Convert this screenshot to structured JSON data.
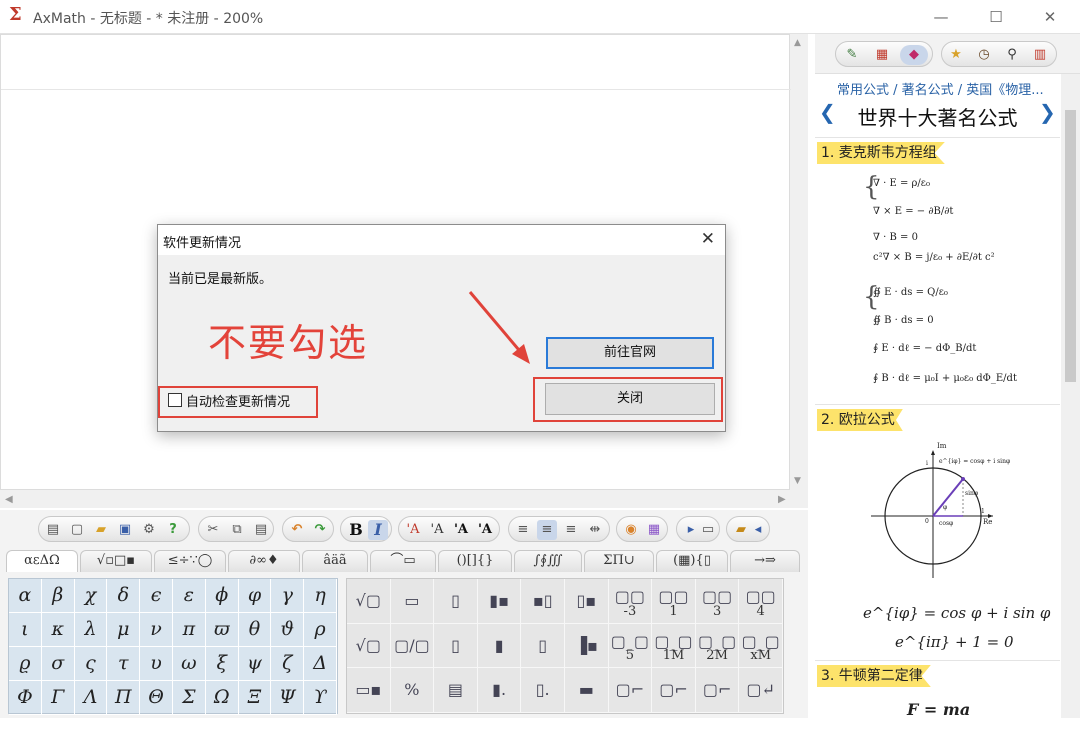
{
  "window": {
    "app_icon": "Σ",
    "title": "AxMath - 无标题 - * 未注册 - 200%",
    "minimize": "—",
    "maximize": "☐",
    "close": "✕"
  },
  "editor": {
    "scroll_up": "▲",
    "scroll_down": "▼",
    "scroll_left": "◀",
    "scroll_right": "▶"
  },
  "toolbar": {
    "bold": "B",
    "italic": "I",
    "font_a1": "'A",
    "font_a2": "'A",
    "font_a3": "'A",
    "font_a4": "'A",
    "undo": "↶",
    "redo": "↷",
    "help": "?"
  },
  "symbol_tabs": [
    "αεΔΩ",
    "√▫□▪",
    "≤÷∵◯",
    "∂∞♦",
    "âäã",
    "⌒▭",
    "()[]{}",
    "∫∮∭",
    "ΣΠ∪",
    "(▦){▯",
    "→⇒"
  ],
  "greek_letters": [
    "α",
    "β",
    "χ",
    "δ",
    "ϵ",
    "ε",
    "ϕ",
    "φ",
    "γ",
    "η",
    "ι",
    "κ",
    "λ",
    "μ",
    "ν",
    "π",
    "ϖ",
    "θ",
    "ϑ",
    "ρ",
    "ϱ",
    "σ",
    "ς",
    "τ",
    "υ",
    "ω",
    "ξ",
    "ψ",
    "ζ",
    "Δ",
    "Φ",
    "Γ",
    "Λ",
    "Π",
    "Θ",
    "Σ",
    "Ω",
    "Ξ",
    "Ψ",
    "ϒ"
  ],
  "templates": [
    {
      "g": "√▢",
      "s": ""
    },
    {
      "g": "▭",
      "s": ""
    },
    {
      "g": "▯",
      "s": ""
    },
    {
      "g": "▮▪",
      "s": ""
    },
    {
      "g": "▪▯",
      "s": ""
    },
    {
      "g": "▯▪",
      "s": ""
    },
    {
      "g": "▢▢",
      "s": "-3"
    },
    {
      "g": "▢▢",
      "s": "1"
    },
    {
      "g": "▢▢",
      "s": "3"
    },
    {
      "g": "▢▢",
      "s": "4"
    },
    {
      "g": "√▢",
      "s": ""
    },
    {
      "g": "▢/▢",
      "s": ""
    },
    {
      "g": "▯",
      "s": ""
    },
    {
      "g": "▮",
      "s": ""
    },
    {
      "g": "▯",
      "s": ""
    },
    {
      "g": "▐▪",
      "s": ""
    },
    {
      "g": "▢_▢",
      "s": "5"
    },
    {
      "g": "▢_▢",
      "s": "1M"
    },
    {
      "g": "▢_▢",
      "s": "2M"
    },
    {
      "g": "▢_▢",
      "s": "xM"
    },
    {
      "g": "▭▪",
      "s": ""
    },
    {
      "g": "%",
      "s": ""
    },
    {
      "g": "▤",
      "s": ""
    },
    {
      "g": "▮.",
      "s": ""
    },
    {
      "g": "▯.",
      "s": ""
    },
    {
      "g": "▬",
      "s": ""
    },
    {
      "g": "▢⌐",
      "s": ""
    },
    {
      "g": "▢⌐",
      "s": ""
    },
    {
      "g": "▢⌐",
      "s": ""
    },
    {
      "g": "▢↵",
      "s": ""
    }
  ],
  "right_panel": {
    "breadcrumb": "常用公式 / 著名公式 / 英国《物理...",
    "nav_prev": "❮",
    "nav_next": "❯",
    "title": "世界十大著名公式",
    "sections": [
      {
        "label": "1. 麦克斯韦方程组"
      },
      {
        "label": "2. 欧拉公式"
      },
      {
        "label": "3. 牛顿第二定律"
      }
    ],
    "maxwell_differential": [
      "∇ · E = ρ/ε₀",
      "∇ × E = − ∂B/∂t",
      "∇ · B = 0",
      "c²∇ × B = j/ε₀ + ∂E/∂t c²"
    ],
    "maxwell_integral": [
      "∯ E · ds = Q/ε₀",
      "∯ B · ds = 0",
      "∮ E · dℓ = − dΦ_B/dt",
      "∮ B · dℓ = μ₀I + μ₀ε₀ dΦ_E/dt"
    ],
    "euler_diagram": {
      "axis_im": "Im",
      "axis_re": "Re",
      "point_label": "e^{iφ} = cosφ + i sinφ",
      "sin_label": "sinφ",
      "cos_label": "cosφ",
      "angle": "φ",
      "one_top": "i",
      "one_right": "1",
      "origin": "0"
    },
    "euler_formula_1": "e^{iφ} = cos φ + i sin φ",
    "euler_formula_2": "e^{iπ} + 1 = 0",
    "newton_formula": "F = ma"
  },
  "dialog": {
    "title": "软件更新情况",
    "close": "✕",
    "message": "当前已是最新版。",
    "web_button": "前往官网",
    "close_button": "关闭",
    "checkbox_label": "自动检查更新情况",
    "checkbox_checked": false
  },
  "annotation": {
    "text": "不要勾选",
    "color": "#e3433a"
  },
  "colors": {
    "accent_blue": "#2a7ad8",
    "section_yellow": "#fde36b",
    "highlight_red": "#e0433a",
    "link_blue": "#2962a6"
  }
}
